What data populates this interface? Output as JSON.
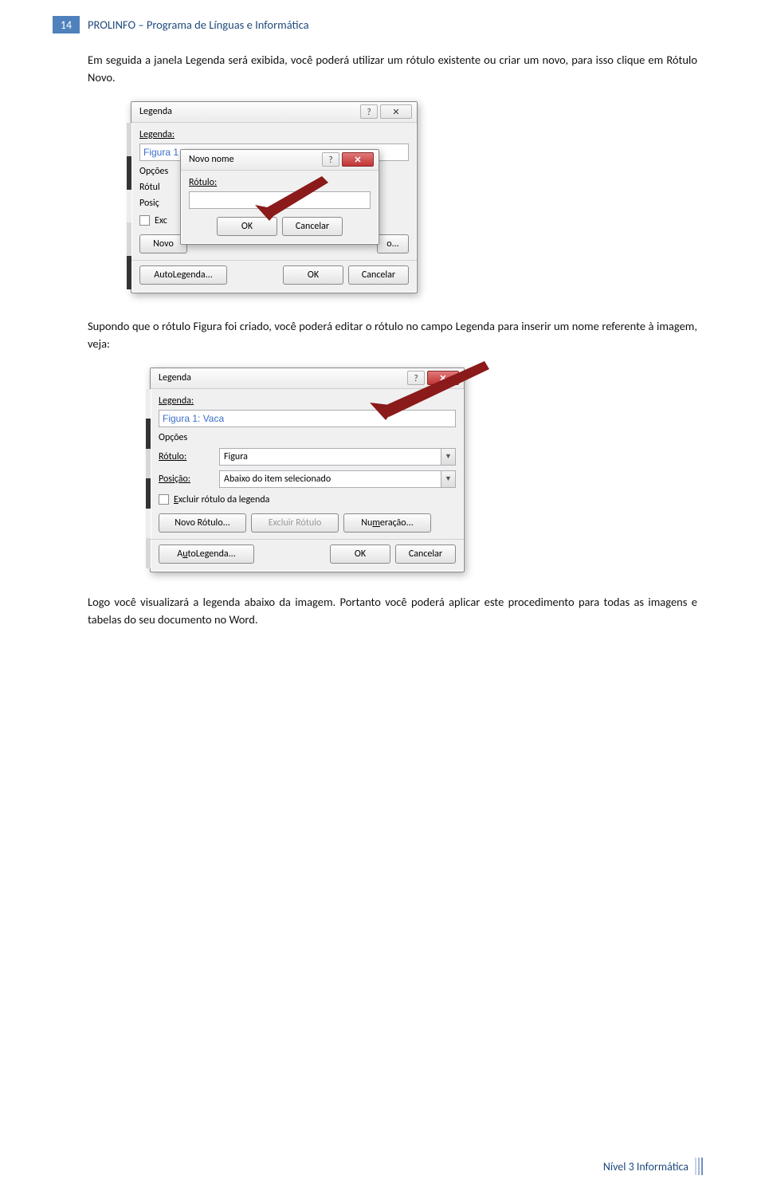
{
  "header": {
    "page_number": "14",
    "title": "PROLINFO – Programa de Línguas e Informática"
  },
  "paragraphs": {
    "p1": "Em seguida a janela Legenda será exibida, você poderá utilizar um rótulo existente ou criar um novo, para isso clique em Rótulo Novo.",
    "p2": "Supondo que o rótulo Figura foi criado, você poderá editar o rótulo no campo Legenda para inserir um nome referente à imagem, veja:",
    "p3": "Logo você visualizará a legenda abaixo da imagem. Portanto você poderá aplicar este procedimento para todas as imagens e tabelas do seu documento no Word."
  },
  "dialog1": {
    "title": "Legenda",
    "legenda_label": "Legenda:",
    "legenda_value": "Figura 1",
    "opcoes_label": "Opções",
    "rotulo_label": "Rótul",
    "posicao_label": "Posiç",
    "exclude_label": "Exc",
    "novo_btn": "Novo",
    "excluir_btn": "o...",
    "auto_btn": "AutoLegenda...",
    "ok_btn": "OK",
    "cancel_btn": "Cancelar",
    "subdialog": {
      "title": "Novo nome",
      "rotulo_label": "Rótulo:",
      "ok_btn": "OK",
      "cancel_btn": "Cancelar"
    }
  },
  "dialog2": {
    "title": "Legenda",
    "legenda_label": "Legenda:",
    "legenda_value": "Figura 1: Vaca",
    "opcoes_label": "Opções",
    "rotulo_label": "Rótulo:",
    "rotulo_value": "Figura",
    "posicao_label": "Posição:",
    "posicao_value": "Abaixo do item selecionado",
    "exclude_label": "Excluir rótulo da legenda",
    "novo_btn": "Novo Rótulo...",
    "excluir_btn": "Excluir Rótulo",
    "numeracao_btn": "Numeração...",
    "auto_btn": "AutoLegenda...",
    "ok_btn": "OK",
    "cancel_btn": "Cancelar"
  },
  "footer": {
    "text": "Nível 3 Informática"
  }
}
